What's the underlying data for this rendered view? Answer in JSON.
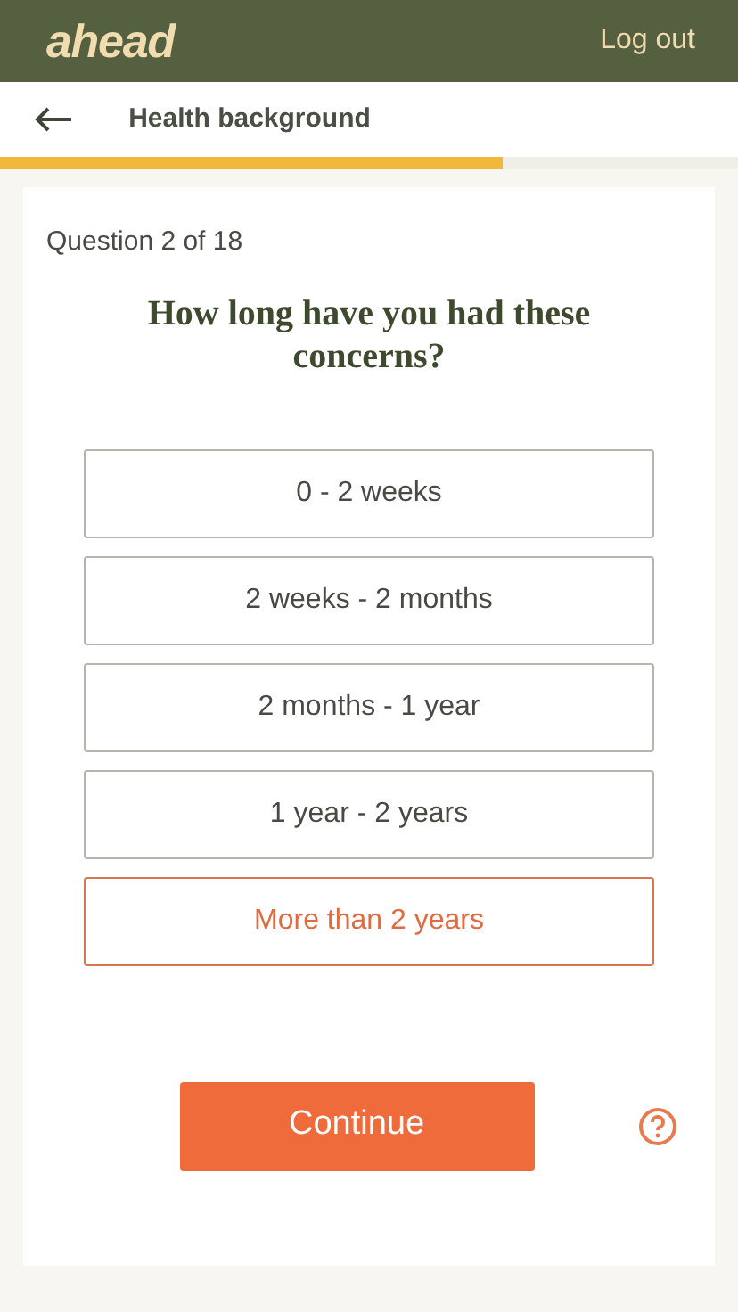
{
  "header": {
    "logo": "ahead",
    "logout": "Log out"
  },
  "nav": {
    "title": "Health background",
    "progress": {
      "level": 0.68
    }
  },
  "question": {
    "counter": "Question 2 of 18",
    "text": "How long have you had these concerns?"
  },
  "options": [
    {
      "label": "0 - 2 weeks",
      "selected": false
    },
    {
      "label": "2 weeks - 2 months",
      "selected": false
    },
    {
      "label": "2 months - 1 year",
      "selected": false
    },
    {
      "label": "1 year - 2 years",
      "selected": false
    },
    {
      "label": "More than 2 years",
      "selected": true
    }
  ],
  "continue": "Continue"
}
